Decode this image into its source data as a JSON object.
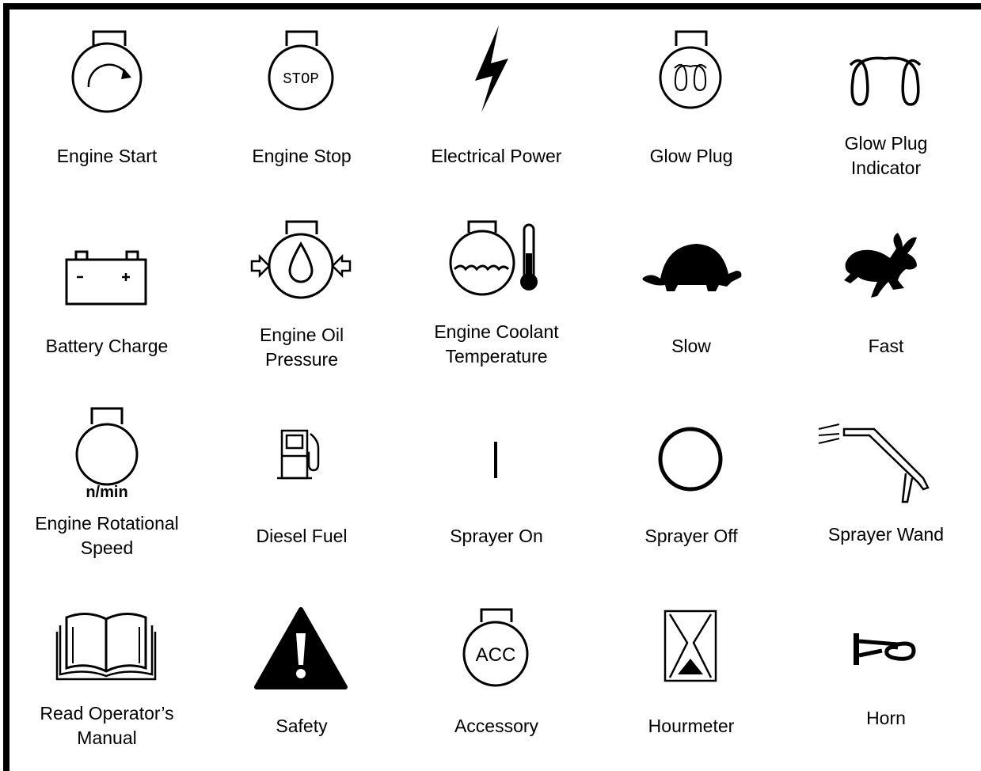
{
  "symbols": [
    {
      "label": "Engine Start",
      "icon": "engine-start-icon"
    },
    {
      "label": "Engine Stop",
      "icon": "engine-stop-icon",
      "icon_text": "STOP"
    },
    {
      "label": "Electrical Power",
      "icon": "lightning-bolt-icon"
    },
    {
      "label": "Glow Plug",
      "icon": "glow-plug-engine-icon"
    },
    {
      "label": "Glow Plug\nIndicator",
      "icon": "glow-plug-coil-icon"
    },
    {
      "label": "Battery Charge",
      "icon": "battery-icon"
    },
    {
      "label": "Engine Oil\nPressure",
      "icon": "oil-pressure-icon"
    },
    {
      "label": "Engine Coolant\nTemperature",
      "icon": "coolant-temperature-icon"
    },
    {
      "label": "Slow",
      "icon": "turtle-icon"
    },
    {
      "label": "Fast",
      "icon": "rabbit-icon"
    },
    {
      "label": "Engine Rotational\nSpeed",
      "icon": "engine-speed-icon",
      "icon_text": "n/min"
    },
    {
      "label": "Diesel Fuel",
      "icon": "fuel-pump-icon"
    },
    {
      "label": "Sprayer On",
      "icon": "on-line-icon"
    },
    {
      "label": "Sprayer Off",
      "icon": "off-circle-icon"
    },
    {
      "label": "Sprayer Wand",
      "icon": "sprayer-wand-icon"
    },
    {
      "label": "Read Operator’s\nManual",
      "icon": "open-book-icon"
    },
    {
      "label": "Safety",
      "icon": "warning-triangle-icon"
    },
    {
      "label": "Accessory",
      "icon": "accessory-icon",
      "icon_text": "ACC"
    },
    {
      "label": "Hourmeter",
      "icon": "hourglass-icon"
    },
    {
      "label": "Horn",
      "icon": "horn-icon"
    }
  ]
}
